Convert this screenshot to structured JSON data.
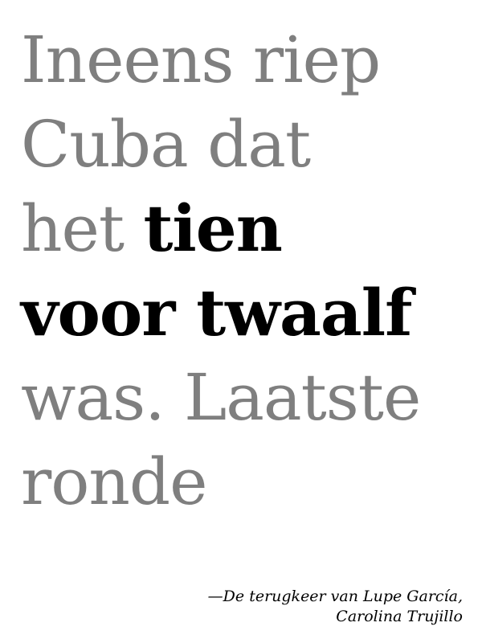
{
  "quote": {
    "line1": "Ineens riep",
    "line2": "Cuba dat",
    "line3_normal": "het ",
    "line3_emphasis": "tien",
    "line4_emphasis": "voor twaalf",
    "line5": "was. Laatste",
    "line6": "ronde"
  },
  "attribution": {
    "line1": "—De terugkeer van Lupe García,",
    "line2": "Carolina Trujillo"
  },
  "colors": {
    "quote_text": "#7f7f7f",
    "emphasis_text": "#000000",
    "background": "#ffffff"
  }
}
